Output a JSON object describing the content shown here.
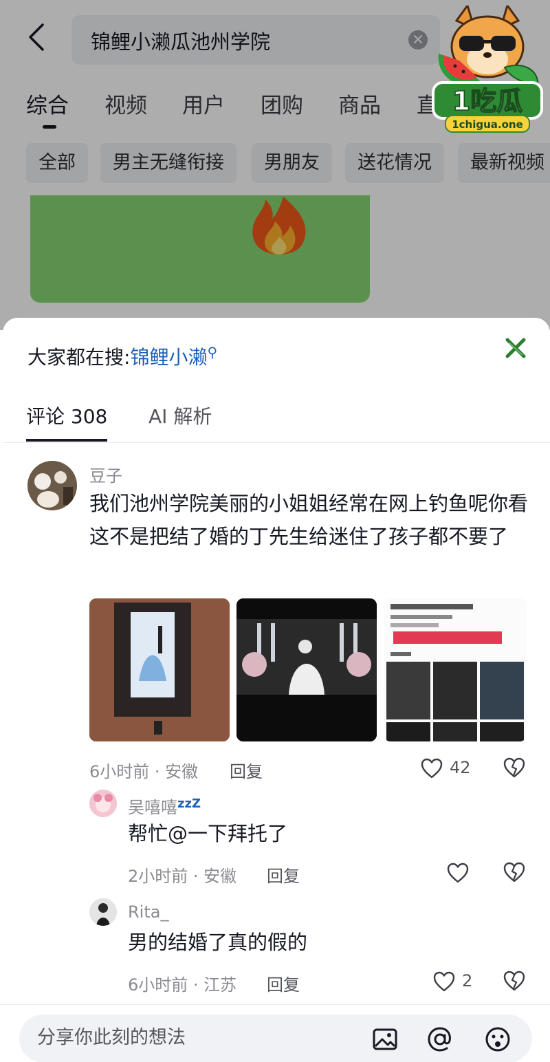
{
  "search": {
    "query": "锦鲤小濑瓜池州学院",
    "clear_symbol": "×"
  },
  "tabs": [
    "综合",
    "视频",
    "用户",
    "团购",
    "商品",
    "直"
  ],
  "active_tab_index": 0,
  "chips": [
    "全部",
    "男主无缝衔接",
    "男朋友",
    "送花情况",
    "最新视频"
  ],
  "logo": {
    "brand": "1吃瓜",
    "domain": "1chigua.one"
  },
  "sheet": {
    "hot_search_prefix": "大家都在搜:",
    "hot_search_keyword": "锦鲤小濑",
    "tabs": [
      {
        "label": "评论 308",
        "active": true
      },
      {
        "label": "AI 解析",
        "active": false
      }
    ]
  },
  "comments": [
    {
      "username": "豆子",
      "text": "我们池州学院美丽的小姐姐经常在网上钓鱼呢你看这不是把结了婚的丁先生给迷住了孩子都不要了",
      "images": [
        "wedding-poster-photo",
        "wedding-ceremony-photo",
        "app-screenshot-photo"
      ],
      "meta": "6小时前 · 安徽",
      "reply_label": "回复",
      "likes": "42"
    }
  ],
  "replies": [
    {
      "username": "吴嘻嘻",
      "badge": "zzZ",
      "text": "帮忙@一下拜托了",
      "meta": "2小时前 · 安徽",
      "reply_label": "回复",
      "likes": ""
    },
    {
      "username": "Rita_",
      "text": "男的结婚了真的假的",
      "meta": "6小时前 · 江苏",
      "reply_label": "回复",
      "likes": "2"
    }
  ],
  "input_bar": {
    "placeholder": "分享你此刻的想法",
    "icons": [
      "image-icon",
      "at-icon",
      "emoji-icon"
    ]
  },
  "colors": {
    "keyword_blue": "#1e5fb8",
    "text_primary": "#161823",
    "text_secondary": "#8a8b91",
    "close_green": "#2e7d32",
    "card_green": "#88d475"
  }
}
